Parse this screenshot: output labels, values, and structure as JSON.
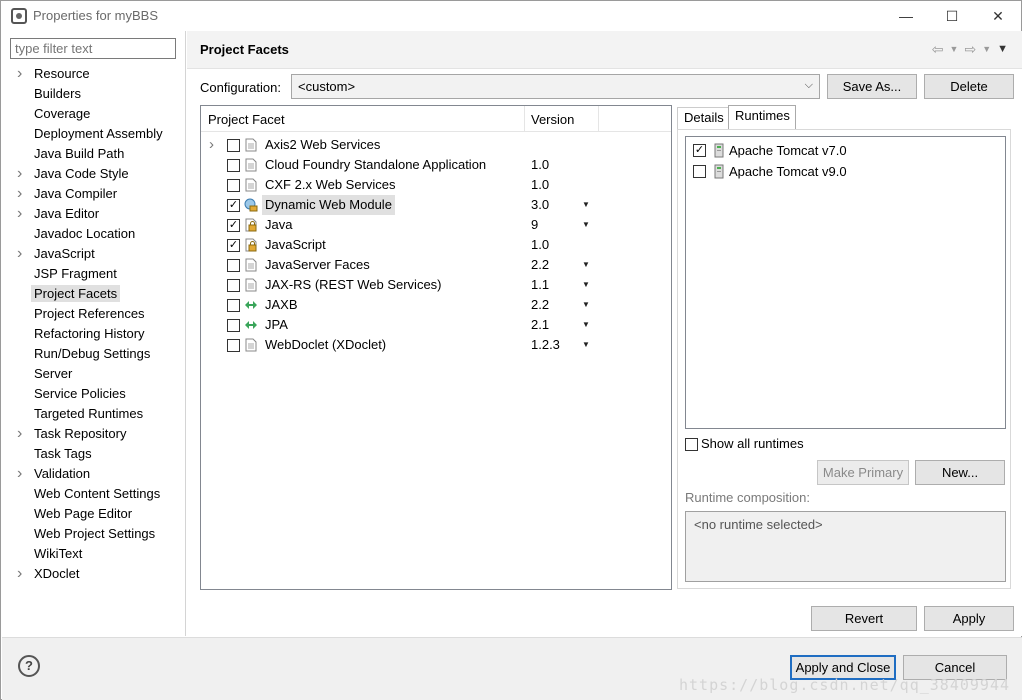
{
  "window": {
    "title": "Properties for myBBS",
    "minimize": "—",
    "maximize": "☐",
    "close": "✕"
  },
  "sidebar": {
    "filter_placeholder": "type filter text",
    "items": [
      {
        "label": "Resource",
        "expandable": true
      },
      {
        "label": "Builders",
        "expandable": false
      },
      {
        "label": "Coverage",
        "expandable": false
      },
      {
        "label": "Deployment Assembly",
        "expandable": false
      },
      {
        "label": "Java Build Path",
        "expandable": false
      },
      {
        "label": "Java Code Style",
        "expandable": true
      },
      {
        "label": "Java Compiler",
        "expandable": true
      },
      {
        "label": "Java Editor",
        "expandable": true
      },
      {
        "label": "Javadoc Location",
        "expandable": false
      },
      {
        "label": "JavaScript",
        "expandable": true
      },
      {
        "label": "JSP Fragment",
        "expandable": false
      },
      {
        "label": "Project Facets",
        "expandable": false,
        "selected": true
      },
      {
        "label": "Project References",
        "expandable": false
      },
      {
        "label": "Refactoring History",
        "expandable": false
      },
      {
        "label": "Run/Debug Settings",
        "expandable": false
      },
      {
        "label": "Server",
        "expandable": false
      },
      {
        "label": "Service Policies",
        "expandable": false
      },
      {
        "label": "Targeted Runtimes",
        "expandable": false
      },
      {
        "label": "Task Repository",
        "expandable": true
      },
      {
        "label": "Task Tags",
        "expandable": false
      },
      {
        "label": "Validation",
        "expandable": true
      },
      {
        "label": "Web Content Settings",
        "expandable": false
      },
      {
        "label": "Web Page Editor",
        "expandable": false
      },
      {
        "label": "Web Project Settings",
        "expandable": false
      },
      {
        "label": "WikiText",
        "expandable": false
      },
      {
        "label": "XDoclet",
        "expandable": true
      }
    ]
  },
  "page": {
    "title": "Project Facets",
    "config_label": "Configuration:",
    "config_value": "<custom>",
    "save_as": "Save As...",
    "delete": "Delete"
  },
  "facets": {
    "col_facet": "Project Facet",
    "col_version": "Version",
    "rows": [
      {
        "name": "Axis2 Web Services",
        "version": "",
        "checked": false,
        "expand": true,
        "dropdown": false,
        "icon": "doc"
      },
      {
        "name": "Cloud Foundry Standalone Application",
        "version": "1.0",
        "checked": false,
        "expand": false,
        "dropdown": false,
        "icon": "doc"
      },
      {
        "name": "CXF 2.x Web Services",
        "version": "1.0",
        "checked": false,
        "expand": false,
        "dropdown": false,
        "icon": "doc"
      },
      {
        "name": "Dynamic Web Module",
        "version": "3.0",
        "checked": true,
        "expand": false,
        "dropdown": true,
        "icon": "lock-globe",
        "highlight": true
      },
      {
        "name": "Java",
        "version": "9",
        "checked": true,
        "expand": false,
        "dropdown": true,
        "icon": "lock"
      },
      {
        "name": "JavaScript",
        "version": "1.0",
        "checked": true,
        "expand": false,
        "dropdown": false,
        "icon": "lock"
      },
      {
        "name": "JavaServer Faces",
        "version": "2.2",
        "checked": false,
        "expand": false,
        "dropdown": true,
        "icon": "doc"
      },
      {
        "name": "JAX-RS (REST Web Services)",
        "version": "1.1",
        "checked": false,
        "expand": false,
        "dropdown": true,
        "icon": "doc"
      },
      {
        "name": "JAXB",
        "version": "2.2",
        "checked": false,
        "expand": false,
        "dropdown": true,
        "icon": "arrows"
      },
      {
        "name": "JPA",
        "version": "2.1",
        "checked": false,
        "expand": false,
        "dropdown": true,
        "icon": "arrows"
      },
      {
        "name": "WebDoclet (XDoclet)",
        "version": "1.2.3",
        "checked": false,
        "expand": false,
        "dropdown": true,
        "icon": "doc"
      }
    ]
  },
  "runtimes_panel": {
    "tab_details": "Details",
    "tab_runtimes": "Runtimes",
    "runtimes": [
      {
        "name": "Apache Tomcat v7.0",
        "checked": true
      },
      {
        "name": "Apache Tomcat v9.0",
        "checked": false
      }
    ],
    "show_all": "Show all runtimes",
    "make_primary": "Make Primary",
    "new": "New...",
    "composition_label": "Runtime composition:",
    "composition_value": "<no runtime selected>"
  },
  "actions": {
    "revert": "Revert",
    "apply": "Apply",
    "apply_close": "Apply and Close",
    "cancel": "Cancel",
    "help": "?"
  },
  "watermark": "https://blog.csdn.net/qq_38409944"
}
